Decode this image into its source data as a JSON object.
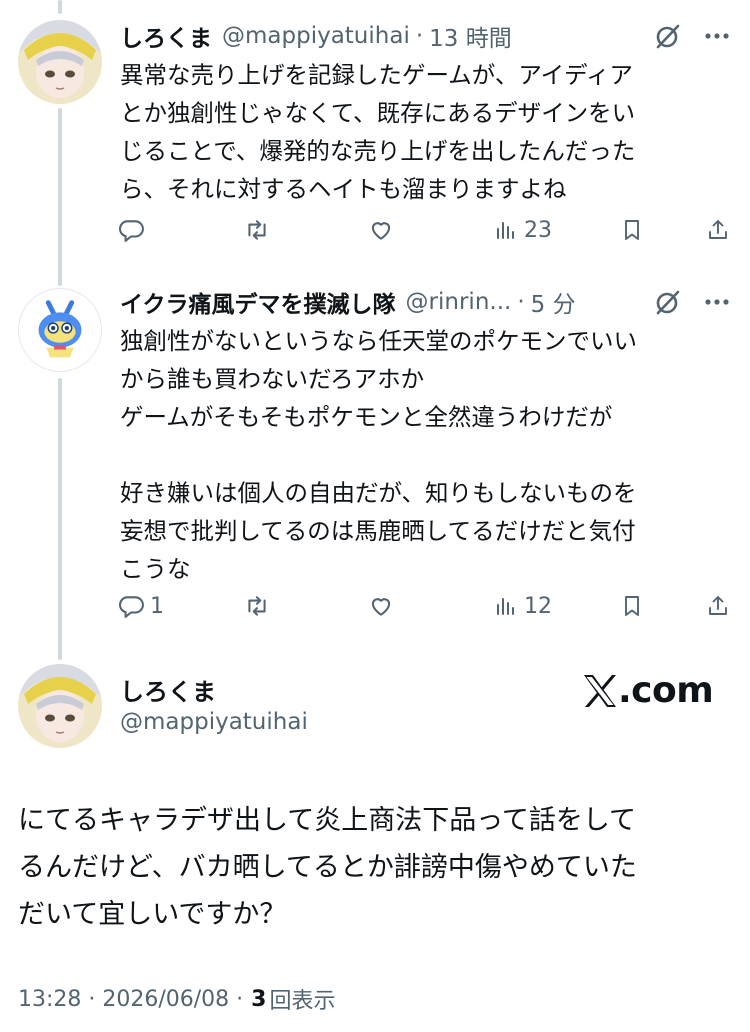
{
  "replies": [
    {
      "name": "しろくま",
      "handle": "@mappiyatuihai",
      "separator": "·",
      "time": "13 時間",
      "text": "異常な売り上げを記録したゲームが、アイディア\nとか独創性じゃなくて、既存にあるデザインをい\nじることで、爆発的な売り上げを出したんだった\nら、それに対するヘイトも溜まりますよね",
      "stats": {
        "replies": "",
        "retweets": "",
        "likes": "",
        "views": "23"
      }
    },
    {
      "name": "イクラ痛風デマを撲滅し隊",
      "handle": "@rinrin...",
      "separator": "·",
      "time": "5 分",
      "text": "独創性がないというなら任天堂のポケモンでいい\nから誰も買わないだろアホか\nゲームがそもそもポケモンと全然違うわけだが\n\n好き嫌いは個人の自由だが、知りもしないものを\n妄想で批判してるのは馬鹿晒してるだけだと気付\nこうな",
      "stats": {
        "replies": "1",
        "retweets": "",
        "likes": "",
        "views": "12"
      }
    }
  ],
  "main_tweet": {
    "name": "しろくま",
    "handle": "@mappiyatuihai",
    "text": "にてるキャラデザ出して炎上商法下品って話をして\nるんだけど、バカ晒してるとか誹謗中傷やめていた\nだいて宜しいですか？",
    "timestamp": "13:28 · 2026/06/08 ·",
    "views_count": "3",
    "views_label": "回表示"
  },
  "brand": {
    "xcom_label": ".com"
  },
  "icons": [
    "reply-icon",
    "retweet-icon",
    "like-icon",
    "views-icon",
    "bookmark-icon",
    "share-icon",
    "grok-icon",
    "more-icon",
    "x-logo-icon"
  ],
  "colors": {
    "text": "#0f1419",
    "secondary": "#536471",
    "thread_line": "#cfd9de"
  }
}
